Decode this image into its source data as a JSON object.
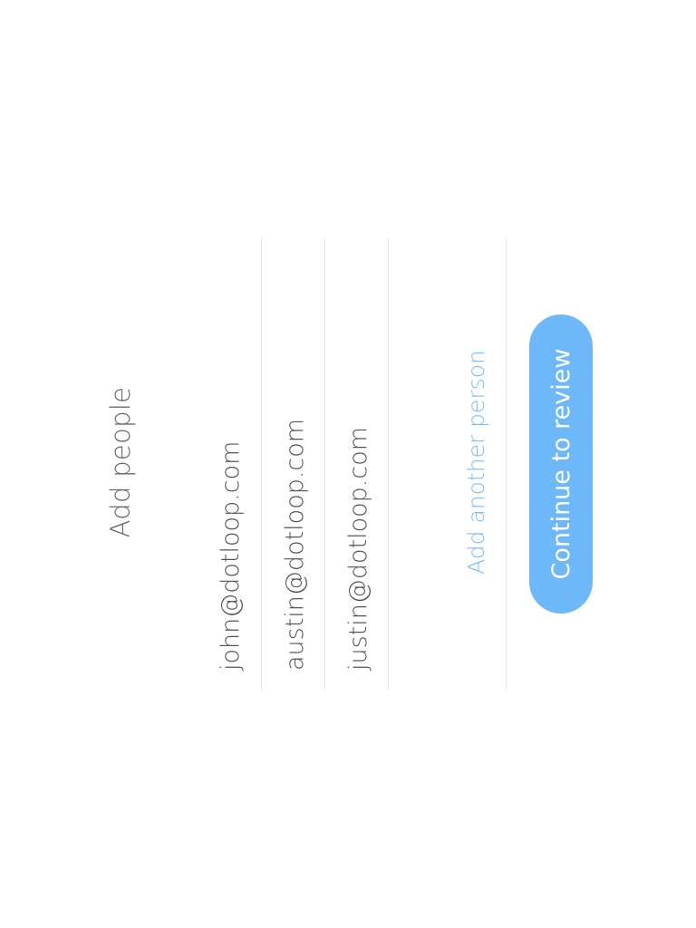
{
  "header": {
    "title": "Add people"
  },
  "people": {
    "emails": [
      "john@dotloop.com",
      "austin@dotloop.com",
      "justin@dotloop.com"
    ],
    "add_label": "Add another person"
  },
  "actions": {
    "continue_label": "Continue to review"
  },
  "colors": {
    "accent": "#6eb7f8",
    "link": "#79bdf9",
    "text": "#555555",
    "divider": "#e6e6e6"
  }
}
